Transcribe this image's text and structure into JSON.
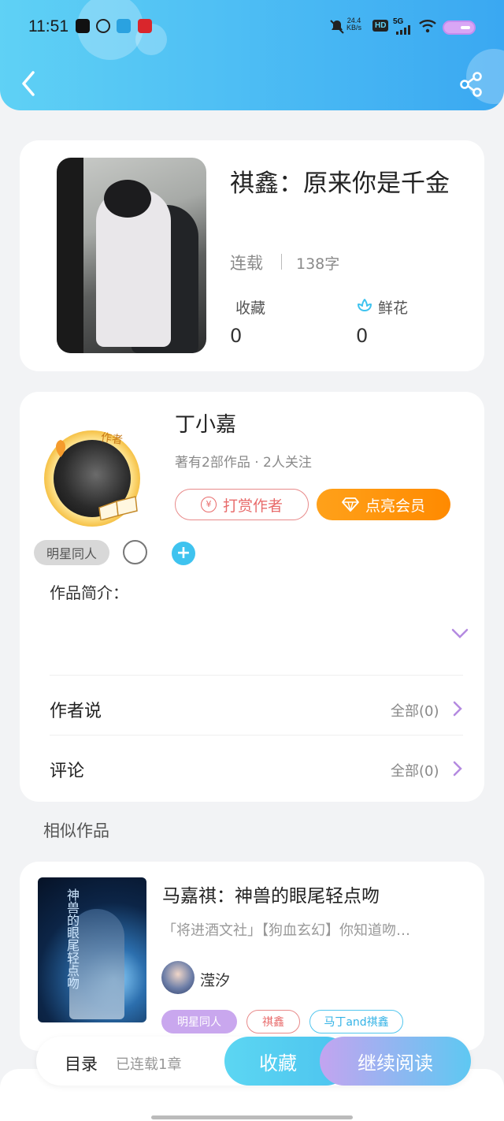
{
  "status_bar": {
    "time": "11:51",
    "net_speed": "24.4",
    "net_unit": "KB/s",
    "hd": "HD",
    "signal": "5G"
  },
  "book": {
    "title": "祺鑫：原来你是千金",
    "status": "连载",
    "words": "138字",
    "favorites_label": "收藏",
    "favorites_count": "0",
    "flowers_label": "鲜花",
    "flowers_count": "0"
  },
  "author": {
    "badge": "作者",
    "name": "丁小嘉",
    "meta": "著有2部作品 · 2人关注",
    "reward_label": "打赏作者",
    "vip_label": "点亮会员",
    "tag": "明星同人"
  },
  "intro_label": "作品简介：",
  "rows": {
    "author_says": {
      "label": "作者说",
      "right": "全部(0)"
    },
    "comments": {
      "label": "评论",
      "right": "全部(0)"
    }
  },
  "similar": {
    "section_title": "相似作品",
    "title": "马嘉祺：神兽的眼尾轻点吻",
    "desc": "「将进酒文社」【狗血玄幻】你知道吻…",
    "author": "滢汐",
    "cover_text": "神兽的眼尾轻点吻",
    "tags": [
      "明星同人",
      "祺鑫",
      "马丁and祺鑫"
    ]
  },
  "bottom": {
    "toc_label": "目录",
    "chapters": "已连载1章",
    "favorite_btn": "收藏",
    "read_btn": "继续阅读"
  },
  "colors": {
    "header_from": "#5fd1f5",
    "header_to": "#3aa8f2",
    "vip": "#ff8a00",
    "reward": "#e86b6b",
    "accent_purple": "#b48ae0"
  }
}
